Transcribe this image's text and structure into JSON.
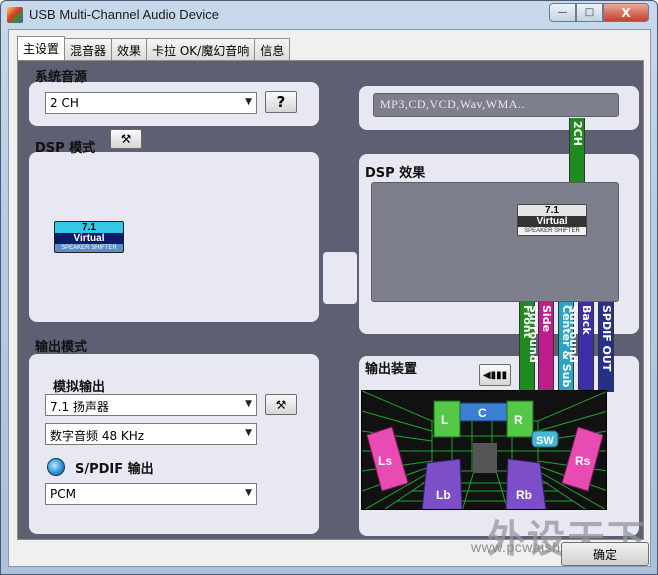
{
  "window": {
    "title": "USB Multi-Channel Audio Device",
    "controls": {
      "minimize": "—",
      "maximize": "□",
      "close": "X"
    }
  },
  "tabs": [
    {
      "label": "主设置",
      "active": true
    },
    {
      "label": "混音器",
      "active": false
    },
    {
      "label": "效果",
      "active": false
    },
    {
      "label": "卡拉 OK/魔幻音响",
      "active": false
    },
    {
      "label": "信息",
      "active": false
    }
  ],
  "source": {
    "heading": "系统音源",
    "select_value": "2 CH",
    "help_label": "?",
    "formats": "MP3,CD,VCD,Wav,WMA.."
  },
  "dsp": {
    "mode_heading": "DSP 模式",
    "effect_heading": "DSP 效果",
    "badge": {
      "num": "7.1",
      "name": "Virtual",
      "sub": "SPEAKER SHIFTER"
    }
  },
  "channel_strips": {
    "top": "2CH",
    "front": "Front",
    "side_surround": "Side Surround",
    "center_sub": "Center & Sub",
    "back_surround": "Back Surround",
    "spdif_out": "SPDIF OUT"
  },
  "output": {
    "mode_heading": "输出模式",
    "analog_heading": "模拟输出",
    "speaker_select": "7.1 扬声器",
    "digital_select": "数字音频 48 KHz",
    "spdif_heading": "S/PDIF 输出",
    "spdif_select": "PCM",
    "device_heading": "输出装置"
  },
  "speakers": [
    "L",
    "C",
    "R",
    "SW",
    "Ls",
    "Rs",
    "Lb",
    "Rb"
  ],
  "footer": {
    "ok_label": "确定",
    "watermark_logo": "外设天下",
    "watermark_url": "www.pcwaishe.cn"
  },
  "colors": {
    "strip_top": "#1f8a1f",
    "strip_front": "#1f8a1f",
    "strip_side": "#c01d8c",
    "strip_center": "#2aa4c6",
    "strip_back": "#3d2fa8",
    "strip_spdif": "#24308a"
  }
}
